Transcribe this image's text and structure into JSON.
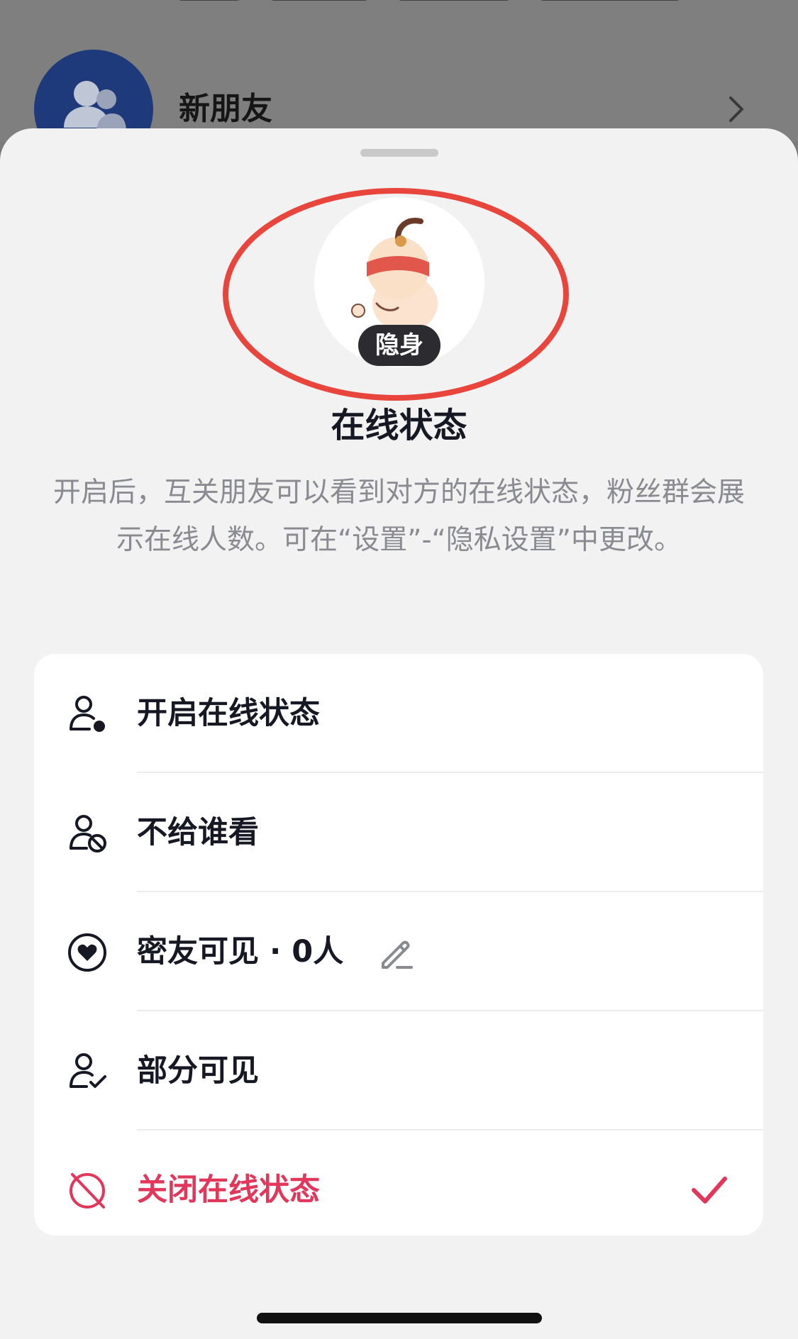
{
  "background_page": {
    "title": "新朋友",
    "avatar_icon": "group-users-icon",
    "chevron_icon": "chevron-right-icon"
  },
  "sheet": {
    "avatar_badge": "隐身",
    "title": "在线状态",
    "description": "开启后，互关朋友可以看到对方的在线状态，粉丝群会展示在线人数。可在“设置”-“隐私设置”中更改。"
  },
  "options": [
    {
      "label": "开启在线状态",
      "icon": "user-online-icon",
      "selected": false
    },
    {
      "label": "不给谁看",
      "icon": "user-blocked-icon",
      "selected": false
    },
    {
      "label": "密友可见 · 0人",
      "icon": "heart-circle-icon",
      "selected": false,
      "edit_icon": "pencil-icon"
    },
    {
      "label": "部分可见",
      "icon": "user-check-icon",
      "selected": false
    },
    {
      "label": "关闭在线状态",
      "icon": "online-off-icon",
      "selected": true,
      "check_icon": "checkmark-icon"
    }
  ],
  "colors": {
    "accent_red": "#e2365a",
    "annotation_ring": "#e8453c",
    "text_primary": "#161823",
    "text_secondary": "#8a8b91",
    "sheet_background": "#f2f2f2",
    "badge_background": "#2c2c30"
  }
}
